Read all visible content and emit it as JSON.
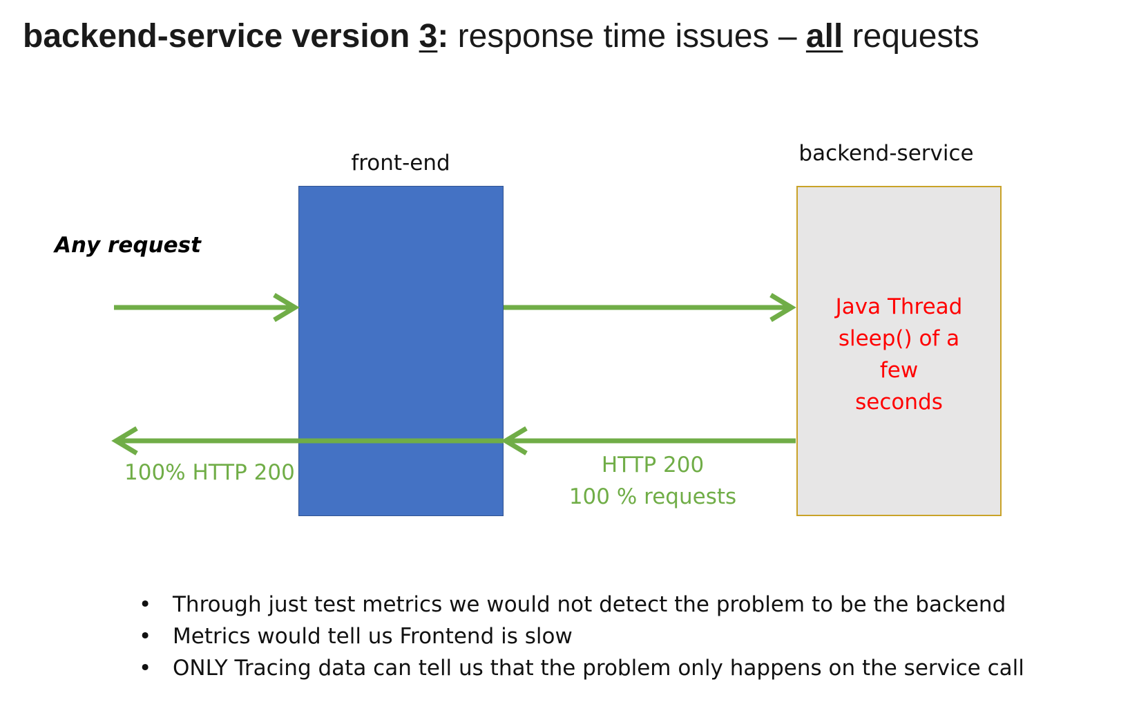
{
  "title": {
    "part1": "backend-service version ",
    "version": "3",
    "part2": ":",
    "part3": " response time issues – ",
    "all": "all",
    "part4": " requests"
  },
  "diagram": {
    "front_end_label": "front-end",
    "backend_label": "backend-service",
    "request_label": "Any request",
    "backend_box_lines": [
      "Java Thread",
      "sleep() of a",
      "few",
      "seconds"
    ],
    "response_left": "100% HTTP 200",
    "response_mid_lines": [
      "HTTP 200",
      "100 % requests"
    ],
    "colors": {
      "front_end_fill": "#4472c4",
      "backend_fill": "#e7e6e6",
      "backend_border": "#c9a227",
      "arrow": "#70ad47",
      "backend_text": "#ff0000"
    }
  },
  "bullets": [
    "Through just test metrics we would not detect the problem to be the backend",
    "Metrics would tell us Frontend is slow",
    "ONLY Tracing data can tell us that the problem only happens on the service call"
  ],
  "bullet_glyph": "•"
}
